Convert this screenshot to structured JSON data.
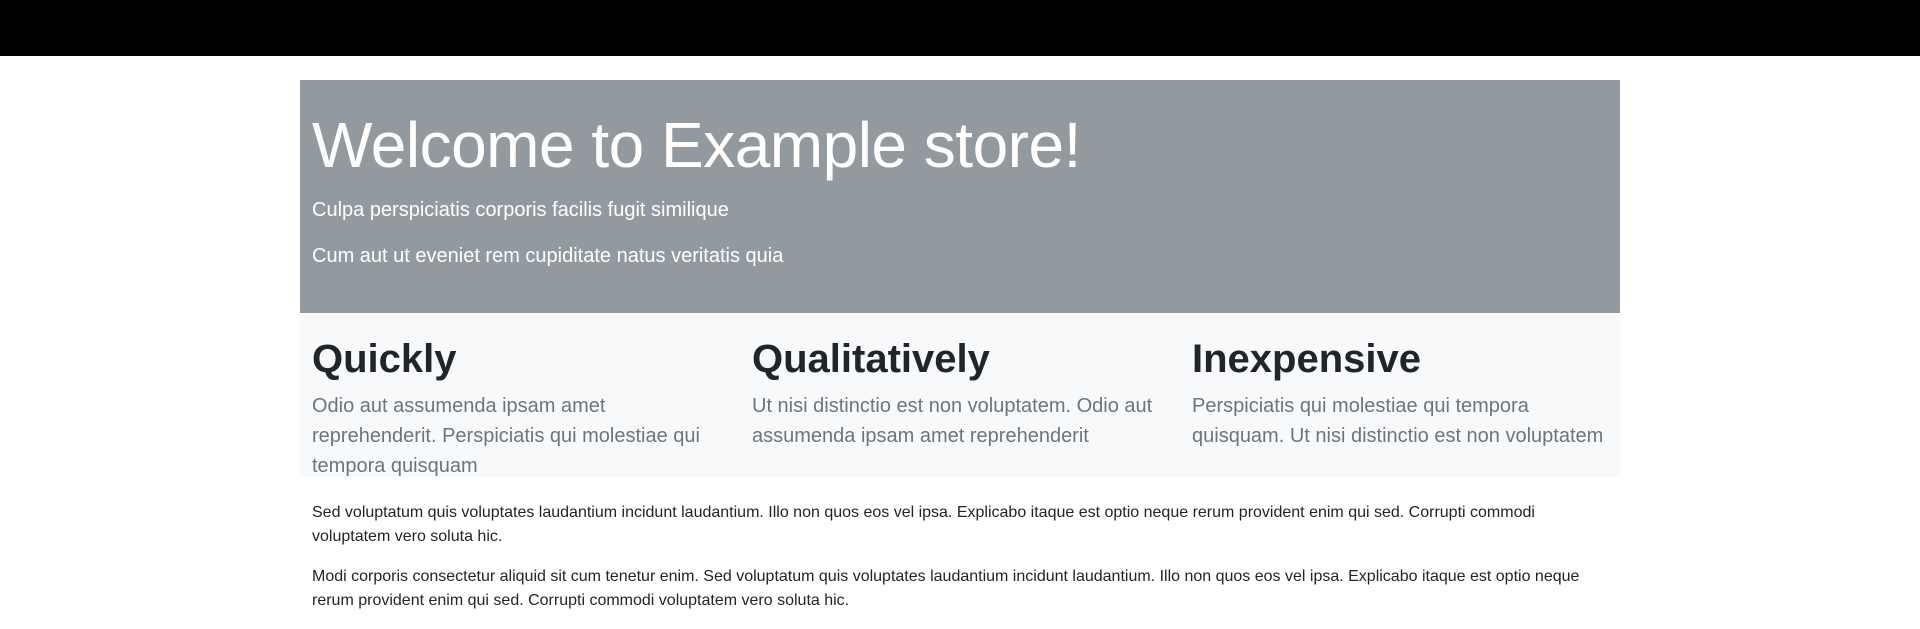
{
  "hero": {
    "title": "Welcome to Example store!",
    "line1": "Culpa perspiciatis corporis facilis fugit similique",
    "line2": "Cum aut ut eveniet rem cupiditate natus veritatis quia"
  },
  "features": [
    {
      "title": "Quickly",
      "text": "Odio aut assumenda ipsam amet reprehenderit. Perspiciatis qui molestiae qui tempora quisquam"
    },
    {
      "title": "Qualitatively",
      "text": "Ut nisi distinctio est non voluptatem. Odio aut assumenda ipsam amet reprehenderit"
    },
    {
      "title": "Inexpensive",
      "text": "Perspiciatis qui molestiae qui tempora quisquam. Ut nisi distinctio est non voluptatem"
    }
  ],
  "body": {
    "paragraph1": "Sed voluptatum quis voluptates laudantium incidunt laudantium. Illo non quos eos vel ipsa. Explicabo itaque est optio neque rerum provident enim qui sed. Corrupti commodi voluptatem vero soluta hic.",
    "paragraph2": "Modi corporis consectetur aliquid sit cum tenetur enim. Sed voluptatum quis voluptates laudantium incidunt laudantium. Illo non quos eos vel ipsa. Explicabo itaque est optio neque rerum provident enim qui sed. Corrupti commodi voluptatem vero soluta hic."
  },
  "colors": {
    "topbar": "#000000",
    "hero_bg": "#939a9f",
    "features_bg": "#f8f9fa",
    "muted_text": "#6c757d"
  }
}
